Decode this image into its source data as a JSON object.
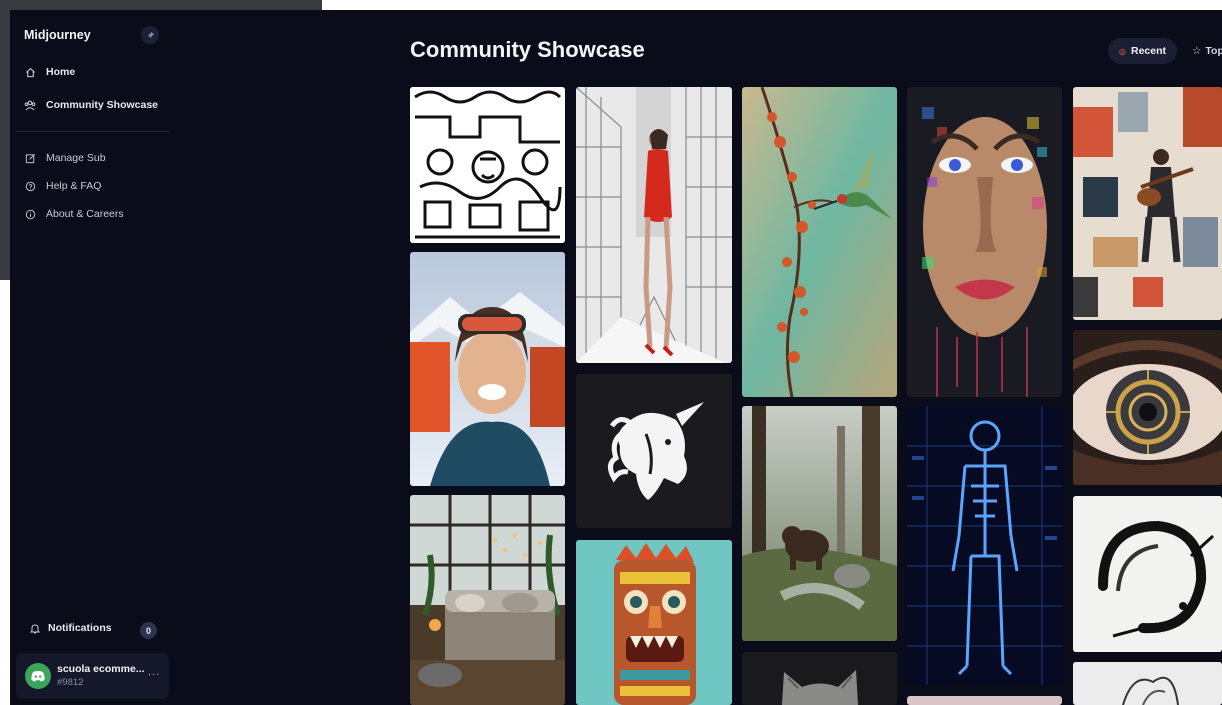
{
  "app": {
    "brand": "Midjourney"
  },
  "sidebar": {
    "primary": [
      {
        "label": "Home",
        "icon": "home-icon"
      },
      {
        "label": "Community Showcase",
        "icon": "community-icon"
      }
    ],
    "secondary": [
      {
        "label": "Manage Sub",
        "icon": "edit-icon"
      },
      {
        "label": "Help & FAQ",
        "icon": "help-icon"
      },
      {
        "label": "About & Careers",
        "icon": "info-icon"
      }
    ],
    "notifications": {
      "label": "Notifications",
      "count": "0"
    },
    "user": {
      "name": "scuola ecomme...",
      "tag": "#9812",
      "more": "..."
    }
  },
  "main": {
    "title": "Community Showcase",
    "filters": [
      {
        "label": "Recent",
        "active": true
      },
      {
        "label": "Top",
        "active": false
      }
    ]
  },
  "gallery": [
    {
      "subject": "black-and-white doodle pattern"
    },
    {
      "subject": "woman in red dress walking in city"
    },
    {
      "subject": "hummingbird on blossom branch"
    },
    {
      "subject": "pixel mosaic woman face"
    },
    {
      "subject": "collage guitarist"
    },
    {
      "subject": "smiling skier selfie in snowy mountains"
    },
    {
      "subject": "unicorn head logo"
    },
    {
      "subject": "bear in misty forest"
    },
    {
      "subject": "holographic human anatomy"
    },
    {
      "subject": "mechanical eye close-up"
    },
    {
      "subject": "cozy greenhouse living room"
    },
    {
      "subject": "colorful tiki mask"
    },
    {
      "subject": "ink brush enso circle"
    },
    {
      "subject": "gray cat"
    },
    {
      "subject": "white flower ink sketch"
    }
  ],
  "colors": {
    "background": "#0b0c1a",
    "accent": "#ff6a4a",
    "discord": "#3ba55c"
  }
}
